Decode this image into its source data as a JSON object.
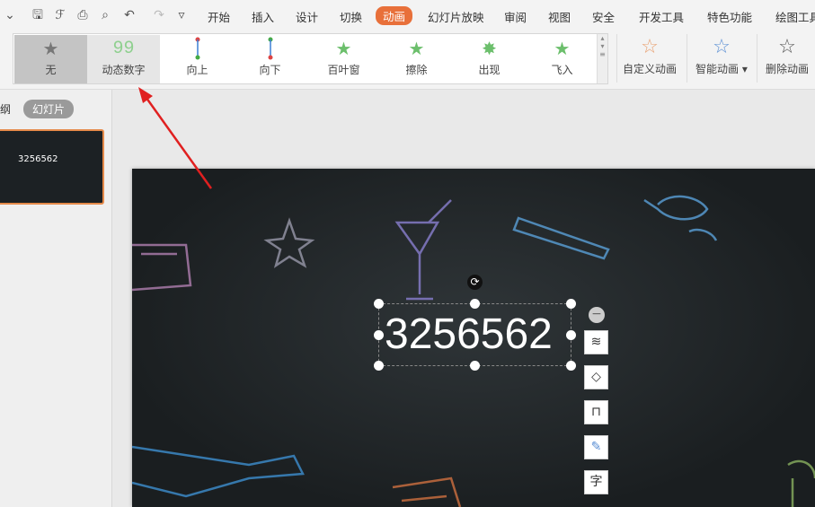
{
  "tabs": [
    "开始",
    "插入",
    "设计",
    "切换",
    "动画",
    "幻灯片放映",
    "审阅",
    "视图",
    "安全",
    "开发工具",
    "特色功能",
    "绘图工具"
  ],
  "active_tab": "动画",
  "gallery": [
    "无",
    "动态数字",
    "向上",
    "向下",
    "百叶窗",
    "擦除",
    "出现",
    "飞入"
  ],
  "buttons": {
    "custom": "自定义动画",
    "smart": "智能动画",
    "delete": "删除动画"
  },
  "left_panel": {
    "outline_tab": "纲",
    "slides_tab": "幻灯片"
  },
  "slide": {
    "number_text": "3256562",
    "thumb_text": "3256562"
  },
  "colors": {
    "accent": "#e8703a",
    "arrow": "#e02020"
  }
}
